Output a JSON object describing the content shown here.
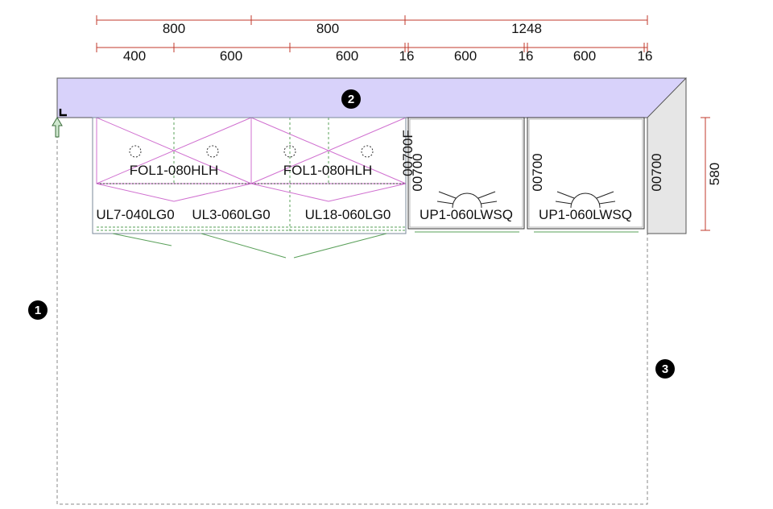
{
  "dimensions": {
    "top_row": [
      "800",
      "800",
      "1248"
    ],
    "second_row": [
      "400",
      "600",
      "600",
      "16",
      "600",
      "16",
      "600",
      "16"
    ],
    "height": "580"
  },
  "markers": [
    "1",
    "2",
    "3"
  ],
  "cabinet_labels": {
    "fol_left": "FOL1-080HLH",
    "fol_right": "FOL1-080HLH",
    "ul7": "UL7-040LG0",
    "ul3": "UL3-060LG0",
    "ul18": "UL18-060LG0",
    "up1_left": "UP1-060LWSQ",
    "up1_right": "UP1-060LWSQ"
  },
  "vertical_labels": {
    "code_f": "00700F",
    "code_a": "00700",
    "code_b": "00700",
    "code_c": "00700"
  },
  "colors": {
    "dimension_line": "#c0392b",
    "worktop_fill": "#d8d2fa",
    "side_panel_fill": "#e6e6e6",
    "cabinet_line": "#d070d0",
    "guide_line": "#5aa05a",
    "badge": "#000000"
  }
}
